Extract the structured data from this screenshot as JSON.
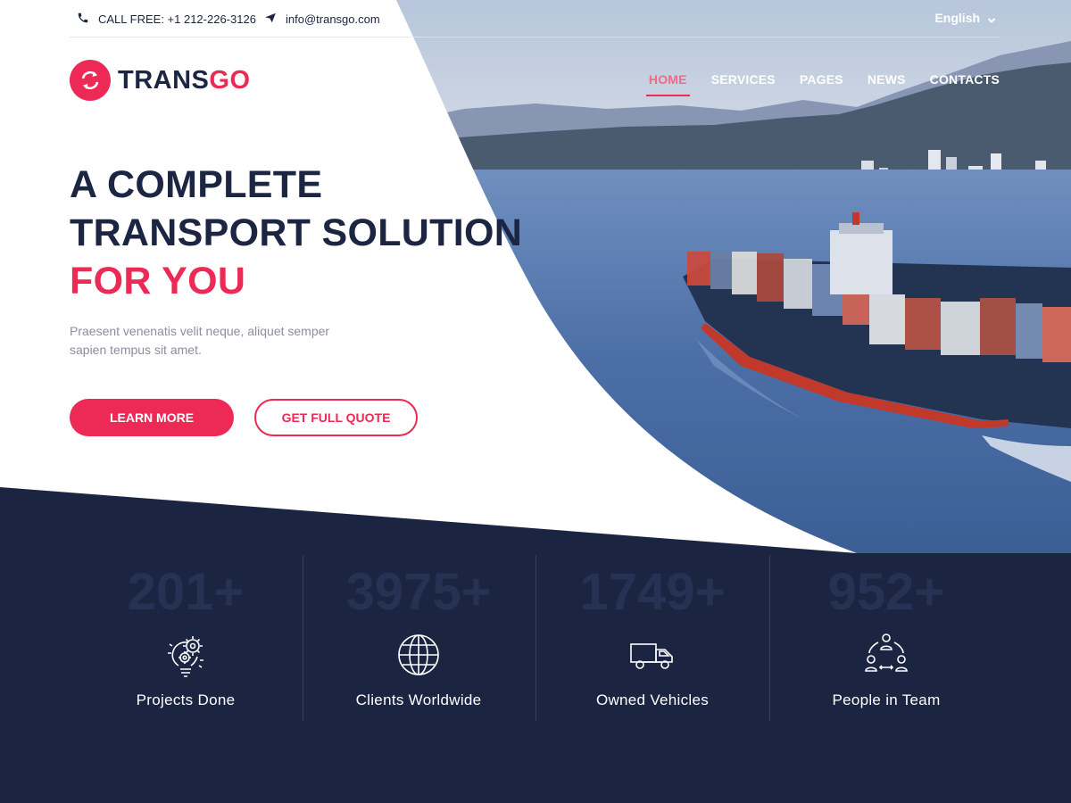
{
  "topbar": {
    "phone_text": "CALL FREE: +1 212-226-3126",
    "email_text": "info@transgo.com",
    "language": "English"
  },
  "logo": {
    "part1": "TRANS",
    "part2": "GO"
  },
  "nav": {
    "items": [
      {
        "label": "HOME",
        "active": true
      },
      {
        "label": "SERVICES",
        "active": false
      },
      {
        "label": "PAGES",
        "active": false
      },
      {
        "label": "NEWS",
        "active": false
      },
      {
        "label": "CONTACTS",
        "active": false
      }
    ]
  },
  "hero": {
    "line1": "A COMPLETE",
    "line2": "TRANSPORT SOLUTION",
    "line3": "FOR YOU",
    "subtext": "Praesent venenatis velit neque, aliquet semper sapien tempus sit amet.",
    "btn_primary": "LEARN MORE",
    "btn_secondary": "GET FULL QUOTE"
  },
  "stats": [
    {
      "number": "201+",
      "label": "Projects Done",
      "icon": "lightbulb-gears-icon"
    },
    {
      "number": "3975+",
      "label": "Clients Worldwide",
      "icon": "globe-icon"
    },
    {
      "number": "1749+",
      "label": "Owned Vehicles",
      "icon": "truck-icon"
    },
    {
      "number": "952+",
      "label": "People in Team",
      "icon": "team-network-icon"
    }
  ],
  "colors": {
    "accent": "#ec2a55",
    "navy": "#1c2541",
    "stats_bg": "#1b2542",
    "muted_number": "#263253"
  }
}
